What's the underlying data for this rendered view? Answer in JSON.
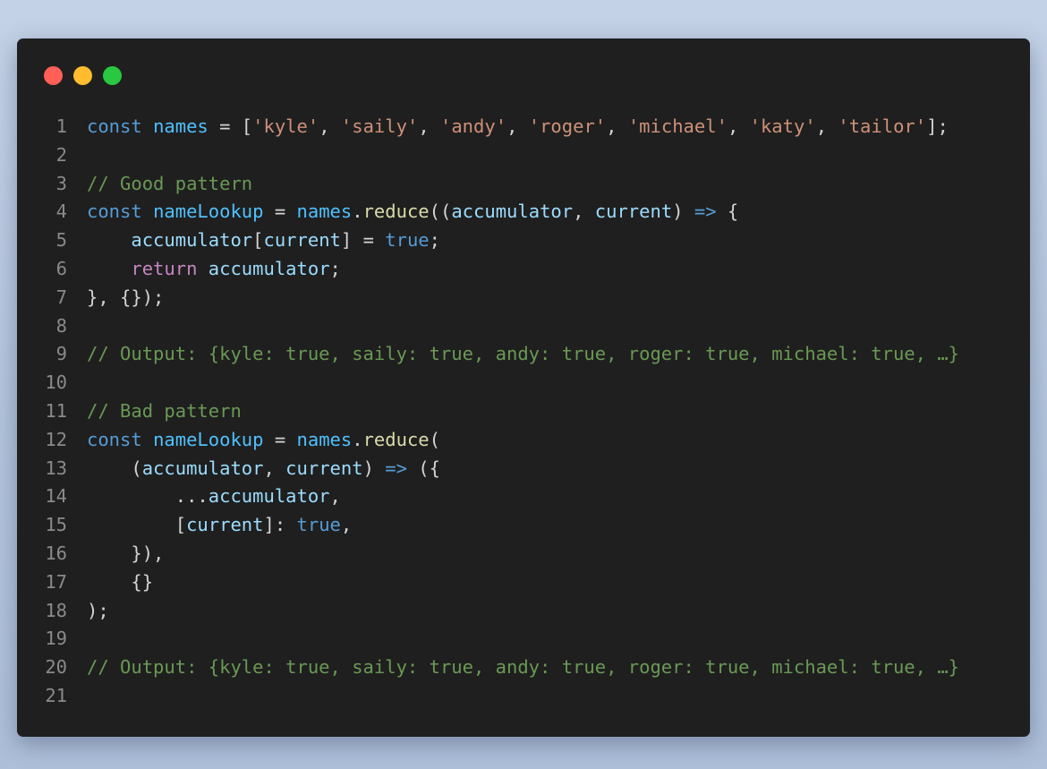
{
  "colors": {
    "dot_close": "#ff5f57",
    "dot_minimize": "#febc2e",
    "dot_zoom": "#28c840",
    "window_background": "#1f1f1f"
  },
  "code_lines": [
    {
      "n": "1",
      "tokens": [
        {
          "t": "const",
          "c": "kw"
        },
        {
          "t": " ",
          "c": "pun"
        },
        {
          "t": "names",
          "c": "const"
        },
        {
          "t": " = [",
          "c": "pun"
        },
        {
          "t": "'kyle'",
          "c": "str"
        },
        {
          "t": ", ",
          "c": "pun"
        },
        {
          "t": "'saily'",
          "c": "str"
        },
        {
          "t": ", ",
          "c": "pun"
        },
        {
          "t": "'andy'",
          "c": "str"
        },
        {
          "t": ", ",
          "c": "pun"
        },
        {
          "t": "'roger'",
          "c": "str"
        },
        {
          "t": ", ",
          "c": "pun"
        },
        {
          "t": "'michael'",
          "c": "str"
        },
        {
          "t": ", ",
          "c": "pun"
        },
        {
          "t": "'katy'",
          "c": "str"
        },
        {
          "t": ", ",
          "c": "pun"
        },
        {
          "t": "'tailor'",
          "c": "str"
        },
        {
          "t": "];",
          "c": "pun"
        }
      ]
    },
    {
      "n": "2",
      "tokens": []
    },
    {
      "n": "3",
      "tokens": [
        {
          "t": "// Good pattern",
          "c": "cmt"
        }
      ]
    },
    {
      "n": "4",
      "tokens": [
        {
          "t": "const",
          "c": "kw"
        },
        {
          "t": " ",
          "c": "pun"
        },
        {
          "t": "nameLookup",
          "c": "const"
        },
        {
          "t": " = ",
          "c": "pun"
        },
        {
          "t": "names",
          "c": "const"
        },
        {
          "t": ".",
          "c": "pun"
        },
        {
          "t": "reduce",
          "c": "fn"
        },
        {
          "t": "((",
          "c": "pun"
        },
        {
          "t": "accumulator",
          "c": "var"
        },
        {
          "t": ", ",
          "c": "pun"
        },
        {
          "t": "current",
          "c": "var"
        },
        {
          "t": ") ",
          "c": "pun"
        },
        {
          "t": "=>",
          "c": "kw"
        },
        {
          "t": " {",
          "c": "pun"
        }
      ]
    },
    {
      "n": "5",
      "tokens": [
        {
          "t": "    ",
          "c": "pun"
        },
        {
          "t": "accumulator",
          "c": "var"
        },
        {
          "t": "[",
          "c": "pun"
        },
        {
          "t": "current",
          "c": "var"
        },
        {
          "t": "] = ",
          "c": "pun"
        },
        {
          "t": "true",
          "c": "kw"
        },
        {
          "t": ";",
          "c": "pun"
        }
      ]
    },
    {
      "n": "6",
      "tokens": [
        {
          "t": "    ",
          "c": "pun"
        },
        {
          "t": "return",
          "c": "ctl"
        },
        {
          "t": " ",
          "c": "pun"
        },
        {
          "t": "accumulator",
          "c": "var"
        },
        {
          "t": ";",
          "c": "pun"
        }
      ]
    },
    {
      "n": "7",
      "tokens": [
        {
          "t": "}, {});",
          "c": "pun"
        }
      ]
    },
    {
      "n": "8",
      "tokens": []
    },
    {
      "n": "9",
      "tokens": [
        {
          "t": "// Output: {kyle: true, saily: true, andy: true, roger: true, michael: true, …}",
          "c": "cmt"
        }
      ]
    },
    {
      "n": "10",
      "tokens": []
    },
    {
      "n": "11",
      "tokens": [
        {
          "t": "// Bad pattern",
          "c": "cmt"
        }
      ]
    },
    {
      "n": "12",
      "tokens": [
        {
          "t": "const",
          "c": "kw"
        },
        {
          "t": " ",
          "c": "pun"
        },
        {
          "t": "nameLookup",
          "c": "const"
        },
        {
          "t": " = ",
          "c": "pun"
        },
        {
          "t": "names",
          "c": "const"
        },
        {
          "t": ".",
          "c": "pun"
        },
        {
          "t": "reduce",
          "c": "fn"
        },
        {
          "t": "(",
          "c": "pun"
        }
      ]
    },
    {
      "n": "13",
      "tokens": [
        {
          "t": "    (",
          "c": "pun"
        },
        {
          "t": "accumulator",
          "c": "var"
        },
        {
          "t": ", ",
          "c": "pun"
        },
        {
          "t": "current",
          "c": "var"
        },
        {
          "t": ") ",
          "c": "pun"
        },
        {
          "t": "=>",
          "c": "kw"
        },
        {
          "t": " ({",
          "c": "pun"
        }
      ]
    },
    {
      "n": "14",
      "tokens": [
        {
          "t": "        ...",
          "c": "pun"
        },
        {
          "t": "accumulator",
          "c": "var"
        },
        {
          "t": ",",
          "c": "pun"
        }
      ]
    },
    {
      "n": "15",
      "tokens": [
        {
          "t": "        [",
          "c": "pun"
        },
        {
          "t": "current",
          "c": "var"
        },
        {
          "t": "]: ",
          "c": "pun"
        },
        {
          "t": "true",
          "c": "kw"
        },
        {
          "t": ",",
          "c": "pun"
        }
      ]
    },
    {
      "n": "16",
      "tokens": [
        {
          "t": "    }),",
          "c": "pun"
        }
      ]
    },
    {
      "n": "17",
      "tokens": [
        {
          "t": "    {}",
          "c": "pun"
        }
      ]
    },
    {
      "n": "18",
      "tokens": [
        {
          "t": ");",
          "c": "pun"
        }
      ]
    },
    {
      "n": "19",
      "tokens": []
    },
    {
      "n": "20",
      "tokens": [
        {
          "t": "// Output: {kyle: true, saily: true, andy: true, roger: true, michael: true, …}",
          "c": "cmt"
        }
      ]
    },
    {
      "n": "21",
      "tokens": []
    }
  ]
}
